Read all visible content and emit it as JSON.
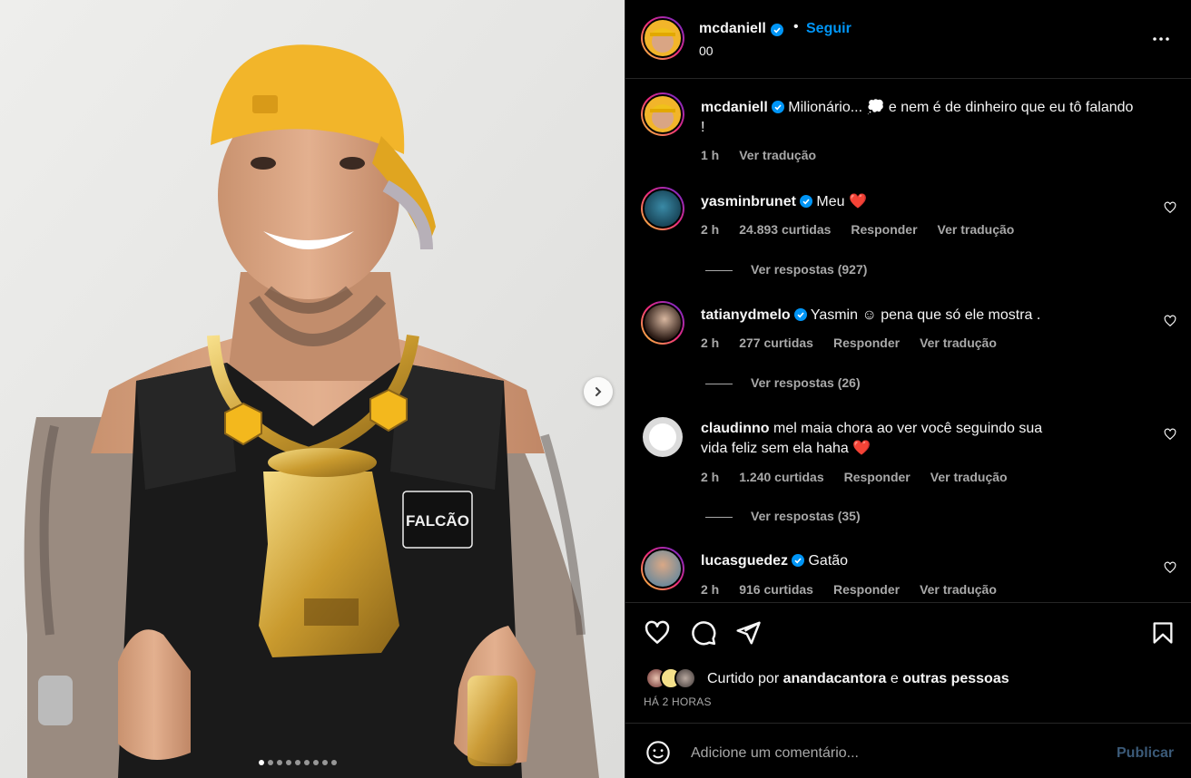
{
  "post": {
    "author": "mcdaniell",
    "follow_label": "Seguir",
    "location": "00",
    "more_icon": "more-horizontal-icon"
  },
  "caption": {
    "username": "mcdaniell",
    "text": "Milionário... 💭 e nem é de dinheiro que eu tô falando !",
    "time": "1 h",
    "translate": "Ver tradução"
  },
  "comments": [
    {
      "username": "yasminbrunet",
      "verified": true,
      "text": "Meu ❤️",
      "time": "2 h",
      "likes": "24.893 curtidas",
      "reply": "Responder",
      "translate": "Ver tradução",
      "replies": "Ver respostas (927)"
    },
    {
      "username": "tatianydmelo",
      "verified": true,
      "text": "Yasmin ☺ pena que só ele mostra .",
      "time": "2 h",
      "likes": "277 curtidas",
      "reply": "Responder",
      "translate": "Ver tradução",
      "replies": "Ver respostas (26)"
    },
    {
      "username": "claudinno",
      "verified": false,
      "text": "mel maia chora ao ver você seguindo sua vida feliz sem ela haha ❤️",
      "time": "2 h",
      "likes": "1.240 curtidas",
      "reply": "Responder",
      "translate": "Ver tradução",
      "replies": "Ver respostas (35)"
    },
    {
      "username": "lucasguedez",
      "verified": true,
      "text": "Gatão",
      "time": "2 h",
      "likes": "916 curtidas",
      "reply": "Responder",
      "translate": "Ver tradução",
      "replies": ""
    }
  ],
  "likes_line": {
    "prefix": "Curtido por",
    "user": "anandacantora",
    "connector": "e",
    "others": "outras pessoas"
  },
  "timestamp": "HÁ 2 HORAS",
  "comment_box": {
    "placeholder": "Adicione um comentário...",
    "publish": "Publicar"
  },
  "photo": {
    "vest_patch": "FALCÃO",
    "carousel_dots": 9,
    "active_dot": 0
  },
  "colors": {
    "accent": "#0095f6",
    "verified": "#0095f6",
    "heart": "#ff3040",
    "muted": "#a8a8a8"
  }
}
